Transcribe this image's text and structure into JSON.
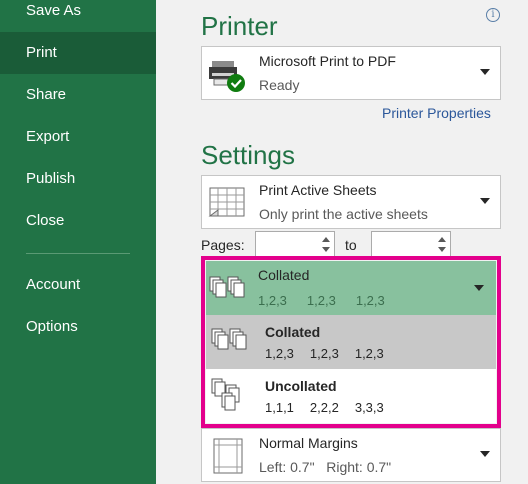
{
  "sidebar": {
    "items": [
      {
        "label": "Save As",
        "active": false
      },
      {
        "label": "Print",
        "active": true
      },
      {
        "label": "Share",
        "active": false
      },
      {
        "label": "Export",
        "active": false
      },
      {
        "label": "Publish",
        "active": false
      },
      {
        "label": "Close",
        "active": false
      },
      {
        "label": "Account",
        "active": false
      },
      {
        "label": "Options",
        "active": false
      }
    ],
    "background_color": "#217346",
    "active_color": "#1a5c38"
  },
  "printer": {
    "title": "Printer",
    "name": "Microsoft Print to PDF",
    "status": "Ready",
    "properties_link": "Printer Properties",
    "info_icon": "info-icon"
  },
  "settings": {
    "title": "Settings",
    "print_what": {
      "title": "Print Active Sheets",
      "subtitle": "Only print the active sheets"
    },
    "pages": {
      "label": "Pages:",
      "from_value": "",
      "to_label": "to",
      "to_value": ""
    },
    "collation": {
      "current": "Collated",
      "current_nums": [
        "1,2,3",
        "1,2,3",
        "1,2,3"
      ],
      "options": [
        {
          "label": "Collated",
          "nums": [
            "1,2,3",
            "1,2,3",
            "1,2,3"
          ],
          "selected": true
        },
        {
          "label": "Uncollated",
          "nums": [
            "1,1,1",
            "2,2,2",
            "3,3,3"
          ],
          "selected": false
        }
      ],
      "highlight_color": "#e3008c"
    },
    "margins": {
      "title": "Normal Margins",
      "left": "Left:  0.7\"",
      "right": "Right:  0.7\""
    }
  },
  "colors": {
    "accent": "#217346",
    "link": "#2b579a",
    "collation_header": "#88c19e"
  }
}
